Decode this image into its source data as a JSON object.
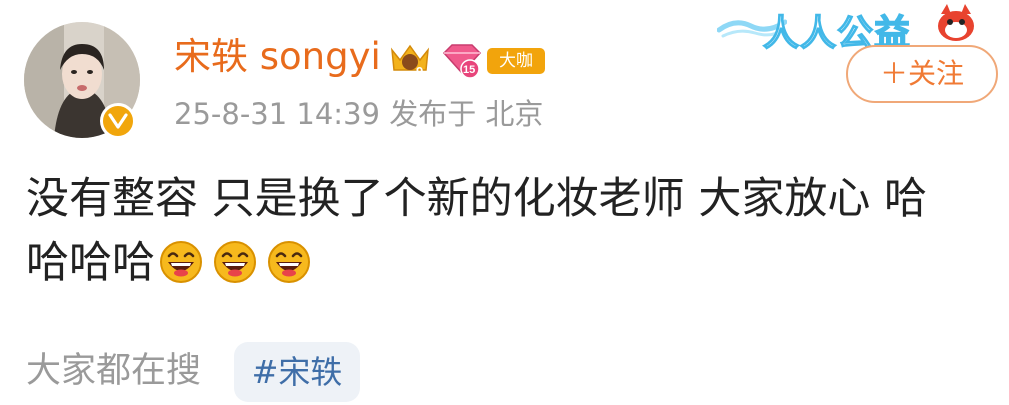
{
  "banner": {
    "text": "人人公益",
    "color_text_outline": "#42b8e8",
    "icon": "fox-mascot-icon"
  },
  "user": {
    "name": "宋轶 songyi",
    "name_color": "#e86b1c",
    "badges": {
      "crown_level": "9",
      "diamond_level": "15",
      "tag": "大咖"
    },
    "verified_icon": "verified-v-icon",
    "verified_color": "#f1a60c"
  },
  "post": {
    "meta": "25-8-31 14:39  发布于 北京",
    "body_line1": "没有整容 只是换了个新的化妆老师 大家放心 哈",
    "body_line2": "哈哈哈",
    "emoji_icon": "laughing-face-icon",
    "emoji_count": 3
  },
  "actions": {
    "follow_label": "＋关注",
    "follow_color": "#f07a34"
  },
  "footer": {
    "search_label": "大家都在搜",
    "hashtag": "#宋轶",
    "hashtag_color": "#3f6ea8"
  }
}
